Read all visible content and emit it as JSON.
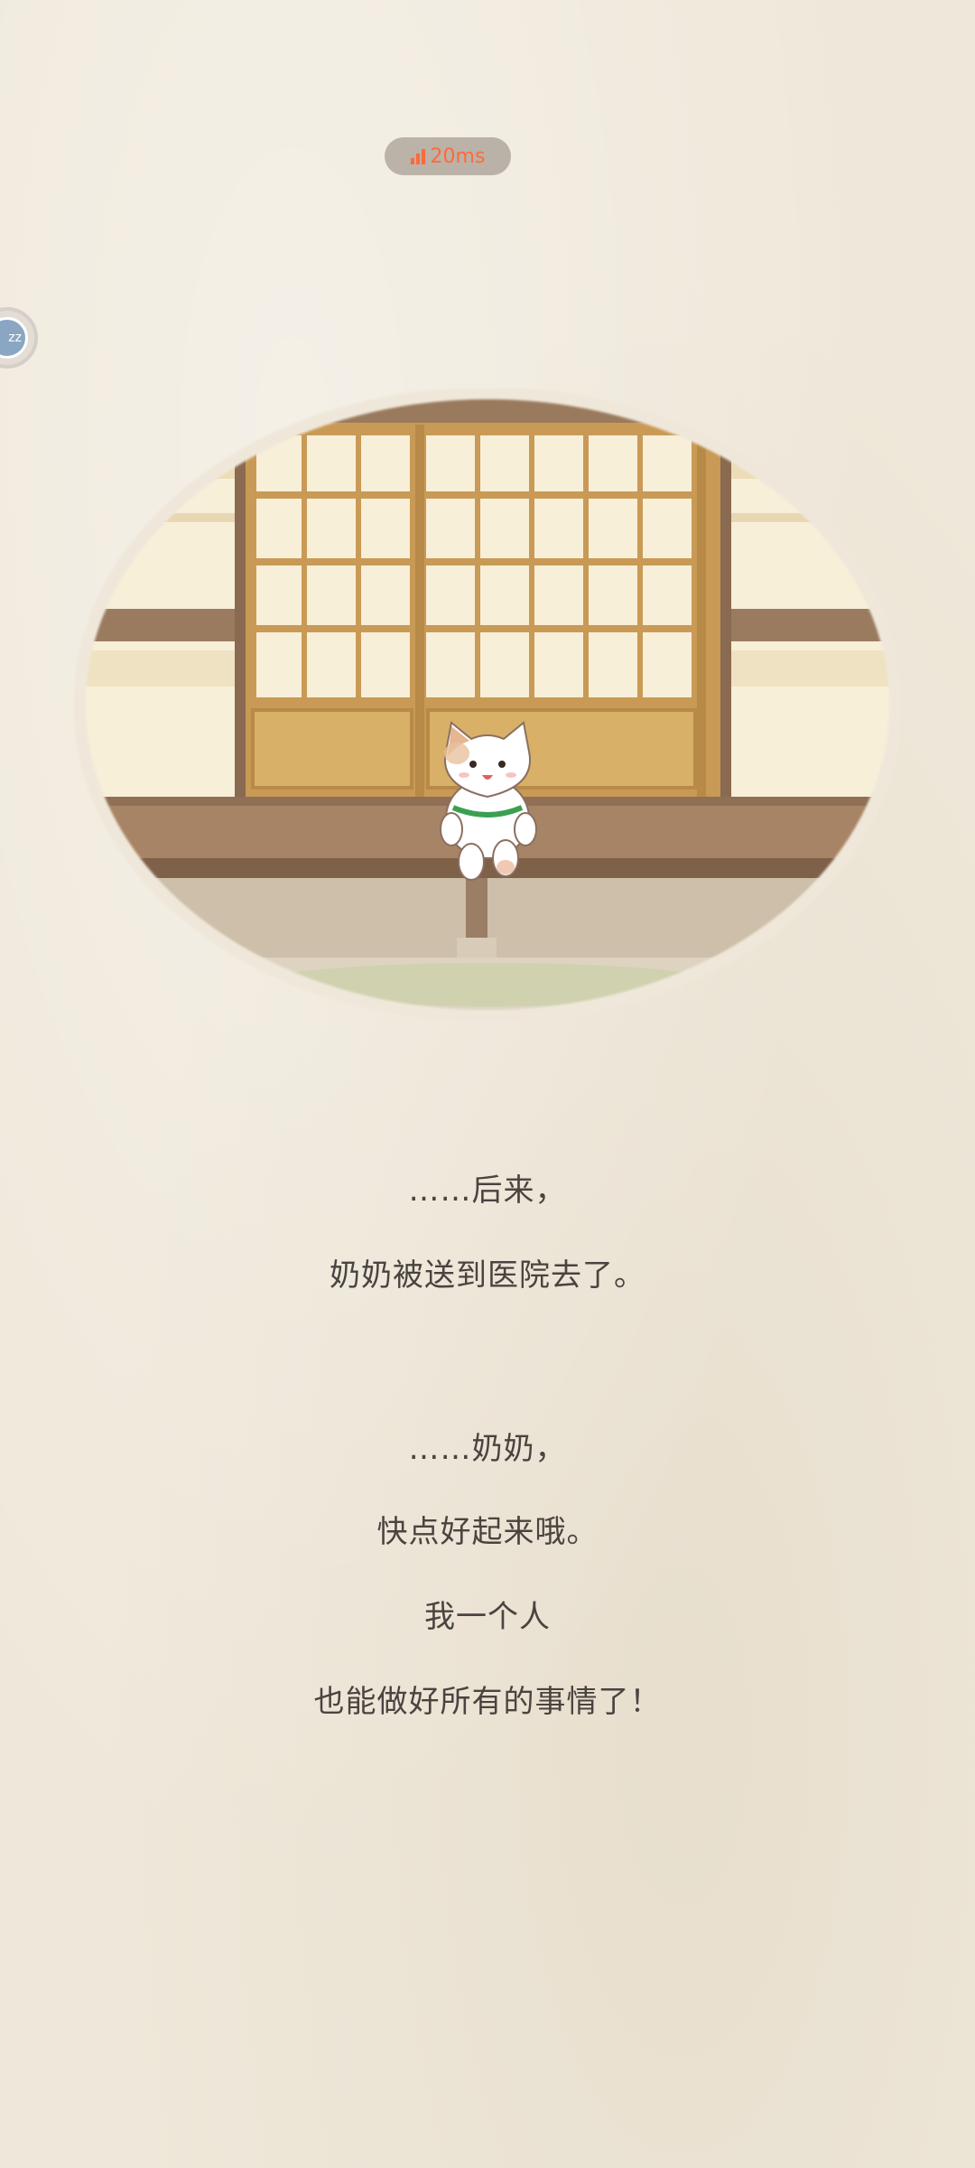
{
  "hud": {
    "ping_text": "20ms",
    "ping_icon": "signal-bars-icon",
    "ping_color": "#ff6a3a",
    "floating_button_text": "zz"
  },
  "scene": {
    "illustration": "cat-sitting-on-veranda-before-shoji-doors",
    "colors": {
      "paper": "#efe8da",
      "wood_dark": "#8f6f55",
      "wood_light": "#c9a15a",
      "shoji_paper": "#f6ecd2",
      "cat_white": "#ffffff",
      "collar": "#3aa050"
    }
  },
  "story": {
    "lines": [
      "……后来，",
      "奶奶被送到医院去了。",
      "……奶奶，",
      "快点好起来哦。",
      "我一个人",
      "也能做好所有的事情了！"
    ]
  }
}
